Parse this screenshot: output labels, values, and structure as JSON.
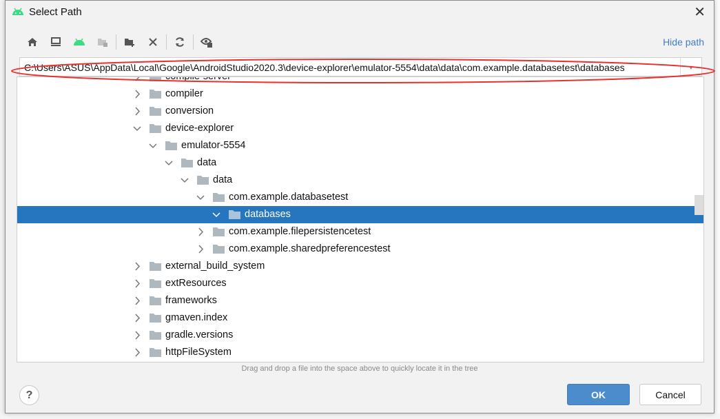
{
  "dialog": {
    "title": "Select Path",
    "hide_path_label": "Hide path",
    "path_value": "C:\\Users\\ASUS\\AppData\\Local\\Google\\AndroidStudio2020.3\\device-explorer\\emulator-5554\\data\\data\\com.example.databasetest\\databases",
    "hint": "Drag and drop a file into the space above to quickly locate it in the tree",
    "ok_label": "OK",
    "cancel_label": "Cancel",
    "help_label": "?"
  },
  "toolbar": [
    "home-icon",
    "desktop-icon",
    "android-icon",
    "module-folder-icon",
    "new-folder-icon",
    "delete-icon",
    "refresh-icon",
    "show-hidden-icon"
  ],
  "colors": {
    "accent": "#2675bf",
    "annotation": "#e8302f",
    "android": "#3ddc84",
    "link": "#3d7fc6"
  },
  "tree": [
    {
      "label": "compile-server",
      "level": 0,
      "state": "collapsed"
    },
    {
      "label": "compiler",
      "level": 0,
      "state": "collapsed"
    },
    {
      "label": "conversion",
      "level": 0,
      "state": "collapsed"
    },
    {
      "label": "device-explorer",
      "level": 0,
      "state": "expanded"
    },
    {
      "label": "emulator-5554",
      "level": 1,
      "state": "expanded"
    },
    {
      "label": "data",
      "level": 2,
      "state": "expanded"
    },
    {
      "label": "data",
      "level": 3,
      "state": "expanded"
    },
    {
      "label": "com.example.databasetest",
      "level": 4,
      "state": "expanded"
    },
    {
      "label": "databases",
      "level": 5,
      "state": "expanded",
      "selected": true
    },
    {
      "label": "com.example.filepersistencetest",
      "level": 4,
      "state": "collapsed"
    },
    {
      "label": "com.example.sharedpreferencestest",
      "level": 4,
      "state": "collapsed"
    },
    {
      "label": "external_build_system",
      "level": 0,
      "state": "collapsed"
    },
    {
      "label": "extResources",
      "level": 0,
      "state": "collapsed"
    },
    {
      "label": "frameworks",
      "level": 0,
      "state": "collapsed"
    },
    {
      "label": "gmaven.index",
      "level": 0,
      "state": "collapsed"
    },
    {
      "label": "gradle.versions",
      "level": 0,
      "state": "collapsed"
    },
    {
      "label": "httpFileSystem",
      "level": 0,
      "state": "collapsed"
    }
  ]
}
